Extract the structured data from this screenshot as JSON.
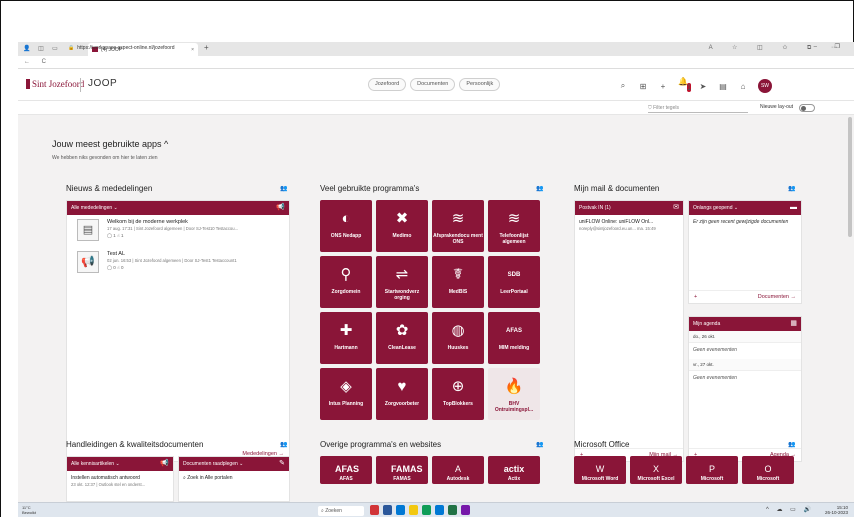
{
  "browser": {
    "tab_title": "(4) JOOP",
    "url": "https://workspace.aspect-online.nl/jozefoord",
    "close_glyph": "×",
    "new_tab_glyph": "+"
  },
  "header": {
    "logo_text": "Sint Jozefoord",
    "app_title": "JOOP",
    "pills": [
      "Jozefoord",
      "Documenten",
      "Persoonlijk"
    ],
    "notification_count": "1",
    "avatar_initials": "SW"
  },
  "subbar": {
    "filter_placeholder": "Filter tegels",
    "new_layout_label": "Nieuwe lay-out"
  },
  "recent": {
    "title": "Jouw meest gebruikte apps ^",
    "subtitle": "We hebben niks gevonden om hier te laten zien"
  },
  "news": {
    "title": "Nieuws & mededelingen",
    "bar_label": "Alle mededelingen ⌄",
    "items": [
      {
        "title": "Welkom bij de moderne werkplek",
        "meta": "17 aug. 17:31 | Sint Jozefoord algemeen | Door SJ-Test10 Testaccou...",
        "stats": "◯ 1  ☝ 1"
      },
      {
        "title": "Test AL",
        "meta": "02 jun. 16:53 | Sint Jozefoord algemeen | Door SJ-Test1 Testaccount1",
        "stats": "◯ 0  ☝ 0"
      }
    ],
    "link": "Mededelingen →"
  },
  "programs": {
    "title": "Veel gebruikte programma's",
    "tiles": [
      {
        "label": "ONS Nedapp",
        "icon": "◐"
      },
      {
        "label": "Medimo",
        "icon": "✖"
      },
      {
        "label": "Afsprakendocu ment ONS",
        "icon": "≋"
      },
      {
        "label": "Telefoonlijst algemeen",
        "icon": "≋"
      },
      {
        "label": "Zorgdomein",
        "icon": "⚲"
      },
      {
        "label": "Startwondverz orging",
        "icon": "⇌"
      },
      {
        "label": "MedBIS",
        "icon": "☤"
      },
      {
        "label": "LeerPortaal",
        "icon": "SDB"
      },
      {
        "label": "Hartmann",
        "icon": "✚"
      },
      {
        "label": "CleanLease",
        "icon": "✿"
      },
      {
        "label": "Huuskes",
        "icon": "◍"
      },
      {
        "label": "MIM melding",
        "icon": "AFAS"
      },
      {
        "label": "Intus Planning",
        "icon": "◈"
      },
      {
        "label": "Zorgvoorbeter",
        "icon": "♥"
      },
      {
        "label": "TopBlokkers",
        "icon": "⊕"
      },
      {
        "label": "BHV Ontruimingspl...",
        "icon": "🔥"
      }
    ]
  },
  "mail": {
    "title": "Mijn mail & documenten",
    "inbox_bar": "Postvak IN (1)",
    "inbox_item": "uniFLOW Online: uniFLOW Onl...",
    "inbox_meta": "noreply@sintjozefoord.eu.un...  ma. 15:49",
    "inbox_link": "Mijn mail →",
    "recent_bar": "Onlangs geopend ⌄",
    "recent_empty": "Er zijn geen recent gewijzigde documenten",
    "recent_link": "Documenten →",
    "agenda_bar": "Mijn agenda",
    "agenda": [
      {
        "day": "do., 26 okt.",
        "event": "Geen evenementen"
      },
      {
        "day": "vr., 27 okt.",
        "event": "Geen evenementen"
      }
    ],
    "agenda_link": "Agenda →",
    "plus": "+"
  },
  "manuals": {
    "title": "Handleidingen & kwaliteitsdocumenten",
    "bar1": "Alle kennisartikelen ⌄",
    "bar2": "Documenten raadplegen ⌄",
    "item_title": "Instellen automatisch antwoord",
    "item_meta": "23 okt. 12:37 | Outlook stel en onderst...",
    "search_placeholder": "Zoek in Alle portalen"
  },
  "other": {
    "title": "Overige programma's en websites",
    "tiles": [
      {
        "label": "AFAS",
        "icon": "AFAS"
      },
      {
        "label": "FAMAS",
        "icon": "FAMAS"
      },
      {
        "label": "Autodesk",
        "icon": "A"
      },
      {
        "label": "Actix",
        "icon": "actix"
      }
    ]
  },
  "office": {
    "title": "Microsoft Office",
    "tiles": [
      {
        "label": "Microsoft Word",
        "icon": "W"
      },
      {
        "label": "Microsoft Excel",
        "icon": "X"
      },
      {
        "label": "Microsoft",
        "icon": "P"
      },
      {
        "label": "Microsoft",
        "icon": "O"
      }
    ]
  },
  "taskbar": {
    "temp": "11°C",
    "weather": "Bewolkt",
    "search": "Zoeken",
    "time": "15:10",
    "date": "26-10-2023"
  }
}
